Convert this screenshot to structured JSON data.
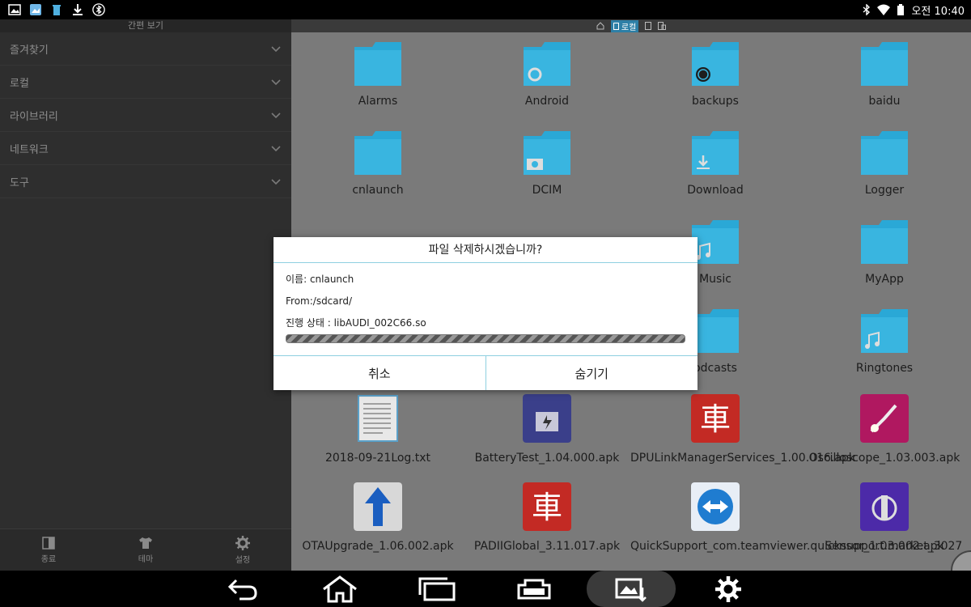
{
  "status": {
    "time": "오전 10:40"
  },
  "sidebar": {
    "title": "간편 보기",
    "items": [
      {
        "label": "즐겨찾기"
      },
      {
        "label": "로컬"
      },
      {
        "label": "라이브러리"
      },
      {
        "label": "네트워크"
      },
      {
        "label": "도구"
      }
    ],
    "tools": [
      {
        "label": "종료",
        "icon": "exit-icon"
      },
      {
        "label": "테마",
        "icon": "shirt-icon"
      },
      {
        "label": "설정",
        "icon": "gear-icon"
      }
    ]
  },
  "path": {
    "current": "로컬"
  },
  "files": [
    {
      "name": "Alarms",
      "kind": "folder"
    },
    {
      "name": "Android",
      "kind": "folder"
    },
    {
      "name": "backups",
      "kind": "folder"
    },
    {
      "name": "baidu",
      "kind": "folder"
    },
    {
      "name": "cnlaunch",
      "kind": "folder"
    },
    {
      "name": "DCIM",
      "kind": "folder"
    },
    {
      "name": "Download",
      "kind": "folder"
    },
    {
      "name": "Logger",
      "kind": "folder"
    },
    {
      "name": "Music",
      "kind": "folder"
    },
    {
      "name": "MyApp",
      "kind": "folder"
    },
    {
      "name": "odcasts",
      "kind": "folder"
    },
    {
      "name": "Ringtones",
      "kind": "folder"
    },
    {
      "name": "2018-09-21Log.txt",
      "kind": "txt"
    },
    {
      "name": "BatteryTest_1.04.000.apk",
      "kind": "apk"
    },
    {
      "name": "DPULinkManagerServices_1.00.016.apk",
      "kind": "apk"
    },
    {
      "name": "Oscilloscope_1.03.003.apk",
      "kind": "apk"
    },
    {
      "name": "OTAUpgrade_1.06.002.apk",
      "kind": "apk"
    },
    {
      "name": "PADIIGlobal_3.11.017.apk",
      "kind": "apk"
    },
    {
      "name": "QuickSupport_com.teamviewer.quicksupport.market_3027",
      "kind": "apk"
    },
    {
      "name": "Sensor_1.03.002.apk",
      "kind": "apk"
    }
  ],
  "dialog": {
    "title": "파일 삭제하시겠습니까?",
    "name_line": "이름: cnlaunch",
    "from_line": "From:/sdcard/",
    "progress_line": "진행 상태 : libAUDI_002C66.so",
    "cancel_label": "취소",
    "hide_label": "숨기기"
  },
  "colors": {
    "accent": "#3aa0cc",
    "folder": "#2aa8d6"
  }
}
